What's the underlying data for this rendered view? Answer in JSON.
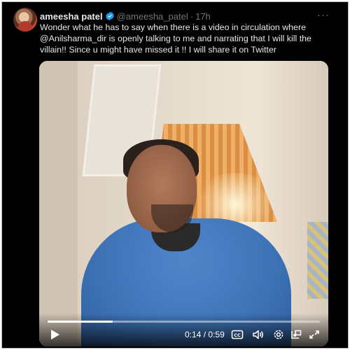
{
  "tweet": {
    "author_name": "ameesha patel",
    "handle": "@ameesha_patel",
    "separator": "·",
    "time": "17h",
    "more_label": "···",
    "text": "Wonder what he has to say when there is a video in circulation where @Anilsharma_dir is openly talking to me and narrating that I will kill the villain!! Since u might have missed it !! I will share it on Twitter"
  },
  "video": {
    "progress_fraction": 0.24,
    "current_time": "0:14",
    "divider": "/",
    "duration": "0:59"
  },
  "icons": {
    "avatar": "profile-avatar",
    "verified": "verified-badge-icon",
    "play": "play-icon",
    "captions": "captions-icon",
    "volume": "volume-icon",
    "settings": "settings-gear-icon",
    "pip": "picture-in-picture-icon",
    "fullscreen": "fullscreen-icon"
  },
  "colors": {
    "background": "#000000",
    "text": "#e7e9ea",
    "muted": "#71767b",
    "verified": "#1d9bf0"
  }
}
